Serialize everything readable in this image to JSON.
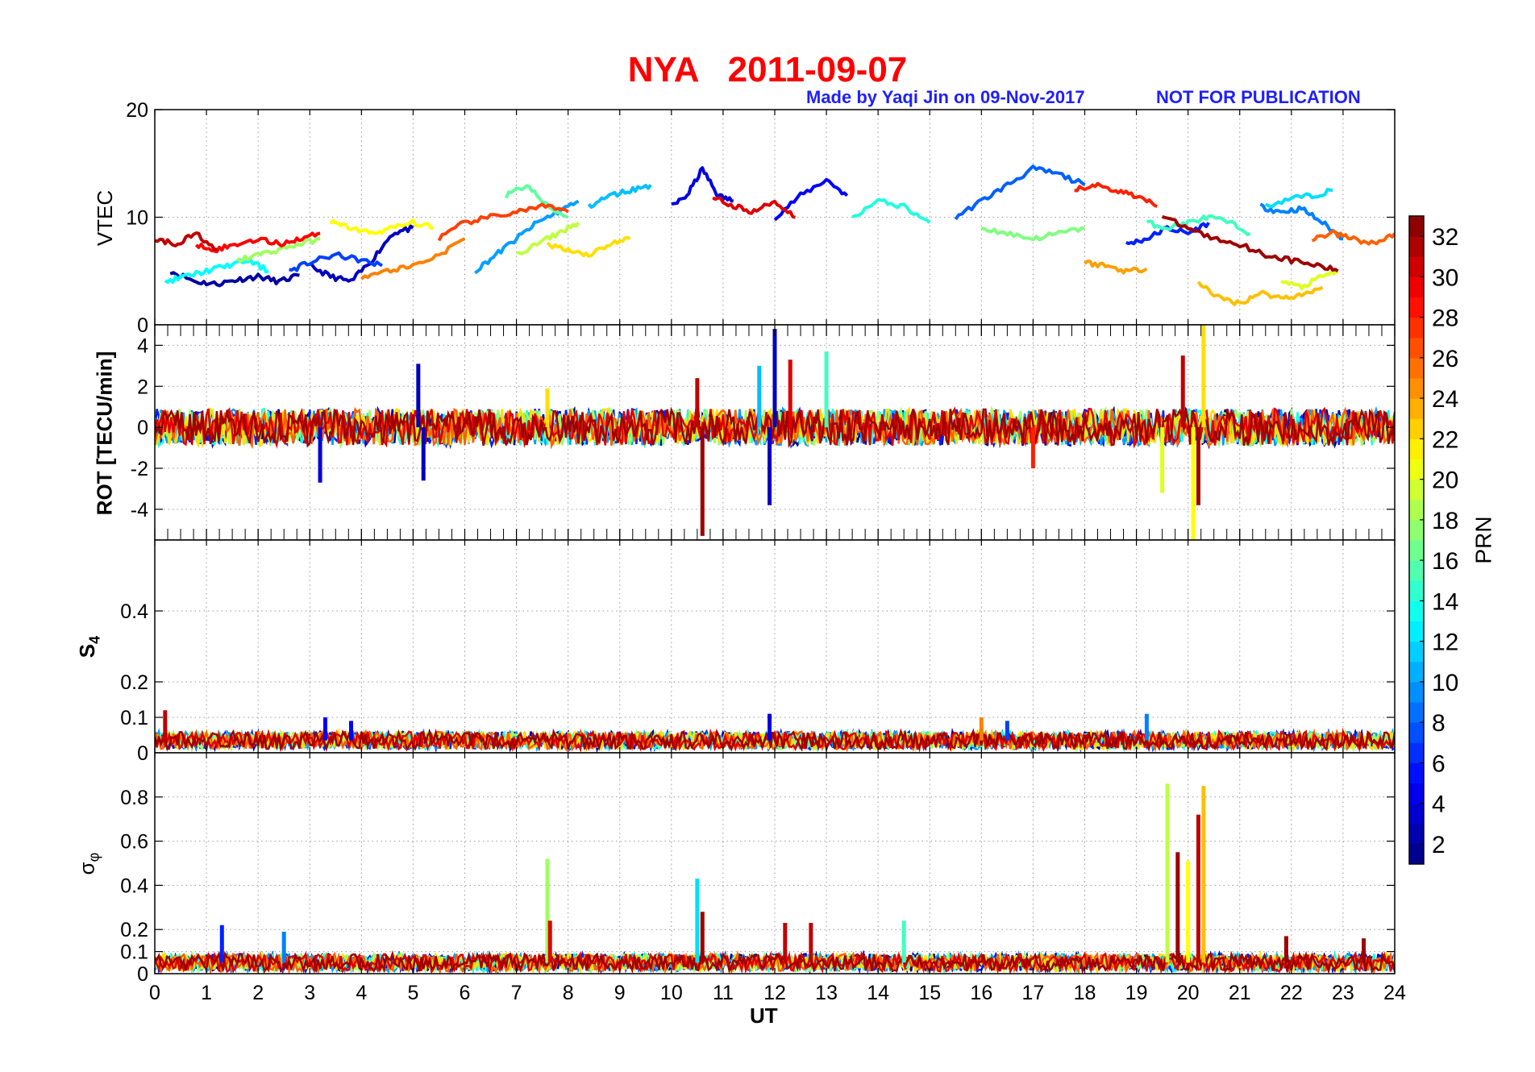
{
  "header": {
    "station": "NYA",
    "date": "2011-09-07",
    "credit": "Made by Yaqi Jin on 09-Nov-2017",
    "notice": "NOT FOR PUBLICATION"
  },
  "colors": {
    "title": "#ff0000",
    "credit": "#1f1fff",
    "colormap": "jet"
  },
  "chart_data": [
    {
      "type": "line",
      "panel": "vtec",
      "ylabel": "VTEC",
      "ylim": [
        0,
        20
      ],
      "yticks": [
        0,
        10,
        20
      ],
      "xlim": [
        0,
        24
      ],
      "grid": true,
      "series": [
        {
          "prn": 2,
          "x": [
            0.3,
            0.8,
            1.2,
            1.6,
            2.0,
            2.4,
            2.8
          ],
          "y": [
            5.0,
            4.0,
            3.8,
            4.2,
            4.5,
            4.0,
            4.6
          ]
        },
        {
          "prn": 3,
          "x": [
            3.0,
            3.4,
            3.8,
            4.2,
            4.6,
            5.0
          ],
          "y": [
            5.5,
            4.5,
            4.0,
            6.0,
            8.5,
            9.0
          ]
        },
        {
          "prn": 4,
          "x": [
            10.0,
            10.3,
            10.6,
            10.9,
            11.2
          ],
          "y": [
            11.0,
            12.0,
            14.5,
            12.0,
            11.5
          ]
        },
        {
          "prn": 5,
          "x": [
            12.0,
            12.5,
            13.0,
            13.4
          ],
          "y": [
            10.0,
            12.0,
            13.5,
            12.0
          ]
        },
        {
          "prn": 6,
          "x": [
            18.8,
            19.2,
            19.6,
            20.0,
            20.4
          ],
          "y": [
            7.5,
            8.0,
            9.0,
            8.5,
            9.5
          ]
        },
        {
          "prn": 7,
          "x": [
            2.6,
            3.0,
            3.5,
            4.0,
            4.4
          ],
          "y": [
            5.0,
            5.8,
            6.5,
            6.0,
            5.5
          ]
        },
        {
          "prn": 8,
          "x": [
            15.5,
            16.0,
            16.5,
            17.0,
            17.5,
            18.0
          ],
          "y": [
            10.0,
            11.5,
            13.0,
            14.5,
            14.0,
            13.0
          ]
        },
        {
          "prn": 9,
          "x": [
            21.4,
            21.8,
            22.2,
            22.6,
            23.0
          ],
          "y": [
            11.0,
            10.5,
            10.8,
            9.5,
            8.0
          ]
        },
        {
          "prn": 10,
          "x": [
            6.2,
            6.6,
            7.0,
            7.4,
            7.8,
            8.2
          ],
          "y": [
            5.0,
            6.5,
            8.0,
            9.5,
            10.5,
            11.5
          ]
        },
        {
          "prn": 11,
          "x": [
            8.4,
            8.8,
            9.2,
            9.6
          ],
          "y": [
            11.0,
            12.0,
            12.5,
            13.0
          ]
        },
        {
          "prn": 12,
          "x": [
            21.5,
            22.0,
            22.4,
            22.8
          ],
          "y": [
            11.0,
            11.8,
            12.0,
            12.5
          ]
        },
        {
          "prn": 13,
          "x": [
            0.2,
            0.6,
            1.0,
            1.4,
            1.8,
            2.2
          ],
          "y": [
            4.0,
            4.5,
            5.0,
            5.5,
            6.0,
            5.0
          ]
        },
        {
          "prn": 14,
          "x": [
            13.5,
            14.0,
            14.5,
            15.0
          ],
          "y": [
            10.0,
            11.5,
            11.0,
            9.5
          ]
        },
        {
          "prn": 15,
          "x": [
            19.2,
            19.6,
            20.0,
            20.4,
            20.8,
            21.2
          ],
          "y": [
            9.5,
            9.0,
            9.5,
            10.0,
            9.5,
            8.5
          ]
        },
        {
          "prn": 16,
          "x": [
            6.8,
            7.2,
            7.6,
            8.0
          ],
          "y": [
            12.0,
            13.0,
            11.0,
            10.0
          ]
        },
        {
          "prn": 17,
          "x": [
            16.0,
            16.5,
            17.0,
            17.5,
            18.0
          ],
          "y": [
            9.0,
            8.5,
            8.0,
            8.5,
            9.0
          ]
        },
        {
          "prn": 18,
          "x": [
            1.6,
            2.0,
            2.4,
            2.8,
            3.2
          ],
          "y": [
            6.0,
            6.5,
            7.0,
            7.5,
            8.0
          ]
        },
        {
          "prn": 19,
          "x": [
            7.0,
            7.4,
            7.8,
            8.2
          ],
          "y": [
            6.5,
            7.5,
            8.5,
            9.5
          ]
        },
        {
          "prn": 20,
          "x": [
            21.8,
            22.2,
            22.6,
            22.9
          ],
          "y": [
            4.0,
            3.5,
            4.5,
            5.0
          ]
        },
        {
          "prn": 21,
          "x": [
            3.4,
            3.8,
            4.2,
            4.6,
            5.0,
            5.4
          ],
          "y": [
            9.5,
            9.0,
            8.5,
            9.0,
            9.5,
            9.0
          ]
        },
        {
          "prn": 22,
          "x": [
            7.6,
            8.0,
            8.4,
            8.8,
            9.2
          ],
          "y": [
            7.5,
            7.0,
            6.5,
            7.5,
            8.0
          ]
        },
        {
          "prn": 23,
          "x": [
            20.2,
            20.6,
            21.0,
            21.4,
            21.8,
            22.2,
            22.6
          ],
          "y": [
            4.0,
            2.5,
            2.0,
            3.0,
            2.5,
            2.8,
            3.5
          ]
        },
        {
          "prn": 24,
          "x": [
            18.0,
            18.4,
            18.8,
            19.2
          ],
          "y": [
            5.8,
            5.5,
            5.0,
            5.2
          ]
        },
        {
          "prn": 25,
          "x": [
            4.0,
            4.5,
            5.0,
            5.5,
            6.0
          ],
          "y": [
            4.5,
            5.0,
            5.5,
            6.5,
            8.0
          ]
        },
        {
          "prn": 26,
          "x": [
            22.4,
            22.8,
            23.2,
            23.6,
            24.0
          ],
          "y": [
            8.0,
            8.5,
            8.0,
            7.5,
            8.5
          ]
        },
        {
          "prn": 27,
          "x": [
            5.5,
            6.0,
            6.5,
            7.0,
            7.5,
            8.0
          ],
          "y": [
            8.0,
            9.5,
            10.0,
            10.5,
            11.0,
            10.5
          ]
        },
        {
          "prn": 28,
          "x": [
            17.8,
            18.2,
            18.6,
            19.0,
            19.4
          ],
          "y": [
            12.5,
            13.0,
            12.5,
            12.0,
            11.0
          ]
        },
        {
          "prn": 29,
          "x": [
            0.8,
            1.2,
            1.6,
            2.0,
            2.4,
            2.8,
            3.2
          ],
          "y": [
            7.5,
            7.0,
            7.5,
            8.0,
            7.5,
            8.0,
            8.5
          ]
        },
        {
          "prn": 30,
          "x": [
            10.8,
            11.2,
            11.6,
            12.0,
            12.4
          ],
          "y": [
            12.0,
            11.0,
            10.5,
            11.5,
            10.0
          ]
        },
        {
          "prn": 31,
          "x": [
            0.0,
            0.4,
            0.8,
            1.2
          ],
          "y": [
            8.0,
            7.5,
            8.5,
            7.0
          ]
        },
        {
          "prn": 32,
          "x": [
            19.5,
            20.0,
            20.5,
            21.0,
            21.5,
            22.0,
            22.5,
            22.9
          ],
          "y": [
            10.0,
            9.0,
            8.0,
            7.5,
            6.5,
            6.0,
            5.5,
            5.0
          ]
        }
      ]
    },
    {
      "type": "line",
      "panel": "rot",
      "ylabel": "ROT [TECU/min]",
      "ylim": [
        -5.5,
        5
      ],
      "yticks": [
        -4,
        -2,
        0,
        2,
        4
      ],
      "xlim": [
        0,
        24
      ],
      "grid": true,
      "spikes": [
        {
          "x": 3.2,
          "y": -2.7,
          "prn": 4
        },
        {
          "x": 5.1,
          "y": 3.1,
          "prn": 3
        },
        {
          "x": 5.2,
          "y": -2.6,
          "prn": 3
        },
        {
          "x": 7.6,
          "y": 1.9,
          "prn": 22
        },
        {
          "x": 10.6,
          "y": -5.3,
          "prn": 32
        },
        {
          "x": 10.5,
          "y": 2.4,
          "prn": 31
        },
        {
          "x": 11.7,
          "y": 3.0,
          "prn": 11
        },
        {
          "x": 12.0,
          "y": 4.8,
          "prn": 3
        },
        {
          "x": 11.9,
          "y": -3.8,
          "prn": 3
        },
        {
          "x": 12.3,
          "y": 3.3,
          "prn": 30
        },
        {
          "x": 13.0,
          "y": 3.7,
          "prn": 15
        },
        {
          "x": 17.0,
          "y": -2.0,
          "prn": 28
        },
        {
          "x": 19.5,
          "y": -3.2,
          "prn": 20
        },
        {
          "x": 19.9,
          "y": 3.5,
          "prn": 31
        },
        {
          "x": 20.3,
          "y": 5.0,
          "prn": 22
        },
        {
          "x": 20.1,
          "y": -5.5,
          "prn": 21
        },
        {
          "x": 20.2,
          "y": -3.8,
          "prn": 32
        }
      ]
    },
    {
      "type": "line",
      "panel": "s4",
      "ylabel": "S4",
      "ylim": [
        0,
        0.6
      ],
      "yticks": [
        0,
        0.1,
        0.2,
        0.4
      ],
      "xlim": [
        0,
        24
      ],
      "grid": true,
      "spikes": [
        {
          "x": 0.2,
          "y": 0.12,
          "prn": 31
        },
        {
          "x": 3.3,
          "y": 0.1,
          "prn": 5
        },
        {
          "x": 3.8,
          "y": 0.09,
          "prn": 5
        },
        {
          "x": 11.9,
          "y": 0.11,
          "prn": 4
        },
        {
          "x": 16.0,
          "y": 0.1,
          "prn": 25
        },
        {
          "x": 16.5,
          "y": 0.09,
          "prn": 7
        },
        {
          "x": 19.2,
          "y": 0.11,
          "prn": 9
        }
      ]
    },
    {
      "type": "line",
      "panel": "sigma_phi",
      "ylabel": "σφ",
      "ylim": [
        0,
        1
      ],
      "yticks": [
        0,
        0.1,
        0.2,
        0.4,
        0.6,
        0.8
      ],
      "xlim": [
        0,
        24
      ],
      "xlabel": "UT",
      "xticks": [
        0,
        1,
        2,
        3,
        4,
        5,
        6,
        7,
        8,
        9,
        10,
        11,
        12,
        13,
        14,
        15,
        16,
        17,
        18,
        19,
        20,
        21,
        22,
        23,
        24
      ],
      "grid": true,
      "spikes": [
        {
          "x": 1.3,
          "y": 0.22,
          "prn": 6
        },
        {
          "x": 2.5,
          "y": 0.19,
          "prn": 9
        },
        {
          "x": 7.6,
          "y": 0.52,
          "prn": 18
        },
        {
          "x": 7.65,
          "y": 0.24,
          "prn": 30
        },
        {
          "x": 10.5,
          "y": 0.43,
          "prn": 12
        },
        {
          "x": 10.6,
          "y": 0.28,
          "prn": 32
        },
        {
          "x": 12.2,
          "y": 0.23,
          "prn": 31
        },
        {
          "x": 12.7,
          "y": 0.23,
          "prn": 31
        },
        {
          "x": 14.5,
          "y": 0.24,
          "prn": 15
        },
        {
          "x": 19.6,
          "y": 0.86,
          "prn": 19
        },
        {
          "x": 19.8,
          "y": 0.55,
          "prn": 32
        },
        {
          "x": 20.0,
          "y": 0.51,
          "prn": 21
        },
        {
          "x": 20.2,
          "y": 0.72,
          "prn": 31
        },
        {
          "x": 20.3,
          "y": 0.85,
          "prn": 23
        },
        {
          "x": 21.9,
          "y": 0.17,
          "prn": 32
        },
        {
          "x": 23.4,
          "y": 0.16,
          "prn": 32
        }
      ]
    }
  ],
  "colorbar": {
    "label": "PRN",
    "min": 1,
    "max": 33,
    "ticks": [
      2,
      4,
      6,
      8,
      10,
      12,
      14,
      16,
      18,
      20,
      22,
      24,
      26,
      28,
      30,
      32
    ]
  }
}
